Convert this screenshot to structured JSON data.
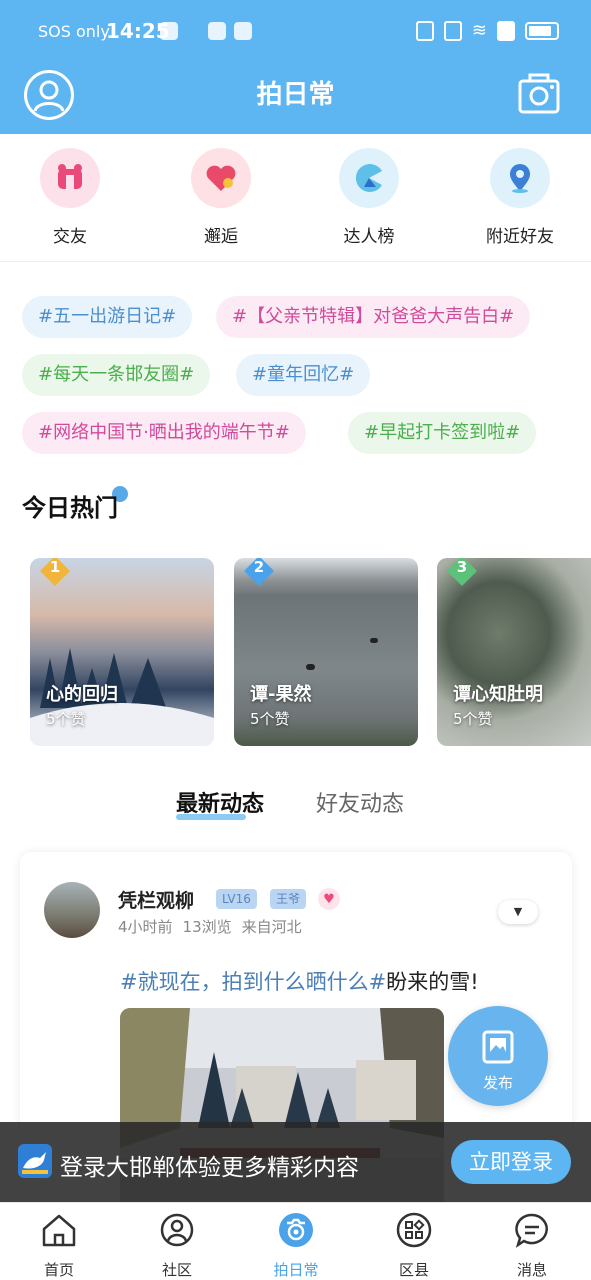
{
  "status_bar": {
    "carrier": "SOS only",
    "time": "14:25"
  },
  "header": {
    "title": "拍日常"
  },
  "quick_entries": [
    {
      "label": "交友",
      "icon": "friends-icon",
      "color": "#e94a7a"
    },
    {
      "label": "邂逅",
      "icon": "heart-icon",
      "color": "#e94a6a"
    },
    {
      "label": "达人榜",
      "icon": "pacman-icon",
      "color": "#3b93e0"
    },
    {
      "label": "附近好友",
      "icon": "location-pin-icon",
      "color": "#3b7fd6"
    }
  ],
  "topics": [
    {
      "label": "#五一出游日记#",
      "style": "blue"
    },
    {
      "label": "#【父亲节特辑】对爸爸大声告白#",
      "style": "pink"
    },
    {
      "label": "#每天一条邯友圈#",
      "style": "green"
    },
    {
      "label": "#童年回忆#",
      "style": "blue"
    },
    {
      "label": "#网络中国节·晒出我的端午节#",
      "style": "pink"
    },
    {
      "label": "#早起打卡签到啦#",
      "style": "green"
    }
  ],
  "hot": {
    "title": "今日热门",
    "cards": [
      {
        "rank": "1",
        "title": "心的回归",
        "likes": "5个赞",
        "rank_color": "#f2b53c"
      },
      {
        "rank": "2",
        "title": "谭-果然",
        "likes": "5个赞",
        "rank_color": "#4aa3ea"
      },
      {
        "rank": "3",
        "title": "谭心知肚明",
        "likes": "5个赞",
        "rank_color": "#5cc27a"
      }
    ]
  },
  "feed_tabs": {
    "active": "最新动态",
    "inactive": "好友动态"
  },
  "post": {
    "author": "凭栏观柳",
    "level": "LV16",
    "role": "王爷",
    "time": "4小时前",
    "views": "13浏览",
    "location": "来自河北",
    "topic": "#就现在，拍到什么晒什么#",
    "text": "盼来的雪!"
  },
  "publish_button": {
    "label": "发布"
  },
  "login_banner": {
    "text": "登录大邯郸体验更多精彩内容",
    "button": "立即登录"
  },
  "bottom_nav": [
    {
      "label": "首页",
      "icon": "home-icon"
    },
    {
      "label": "社区",
      "icon": "community-icon"
    },
    {
      "label": "拍日常",
      "icon": "camera-daily-icon"
    },
    {
      "label": "区县",
      "icon": "district-icon"
    },
    {
      "label": "消息",
      "icon": "message-icon"
    }
  ],
  "colors": {
    "accent": "#5db5f2",
    "active_nav": "#4aa3ea"
  }
}
